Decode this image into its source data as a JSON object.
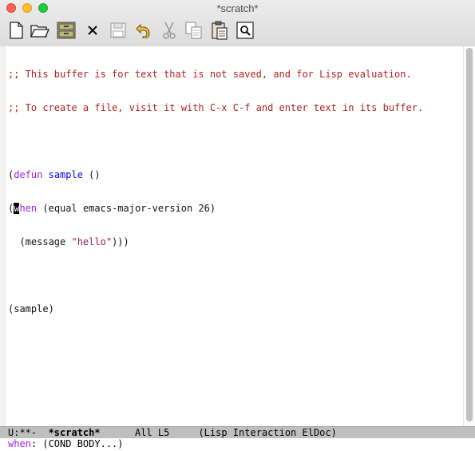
{
  "window": {
    "title": "*scratch*"
  },
  "toolbar": {
    "items": [
      {
        "name": "new-file-icon"
      },
      {
        "name": "open-folder-icon"
      },
      {
        "name": "dired-cabinet-icon"
      },
      {
        "name": "close-icon"
      },
      {
        "name": "save-icon"
      },
      {
        "name": "undo-icon"
      },
      {
        "name": "cut-icon"
      },
      {
        "name": "copy-icon"
      },
      {
        "name": "paste-icon"
      },
      {
        "name": "search-icon"
      }
    ]
  },
  "buffer": {
    "comment1": ";; This buffer is for text that is not saved, and for Lisp evaluation.",
    "comment2": ";; To create a file, visit it with C-x C-f and enter text in its buffer.",
    "l4_open": "(",
    "l4_kw": "defun",
    "l4_sp": " ",
    "l4_fn": "sample",
    "l4_rest": " ()",
    "l5_open": "(",
    "l5_cursor": "w",
    "l5_kw": "hen",
    "l5_rest": " (equal emacs-major-version 26)",
    "l6_pre": "  (message ",
    "l6_str": "\"hello\"",
    "l6_post": ")))",
    "l8": "(sample)"
  },
  "modeline": {
    "status": "U:**-",
    "buffer_name": "*scratch*",
    "position": "All L5",
    "modes": "(Lisp Interaction ElDoc)"
  },
  "echo": {
    "keyword": "when",
    "signature": ": (COND BODY...)"
  },
  "colors": {
    "comment": "#b22222",
    "keyword": "#a020f0",
    "function": "#0000ff",
    "string": "#8b2252"
  }
}
